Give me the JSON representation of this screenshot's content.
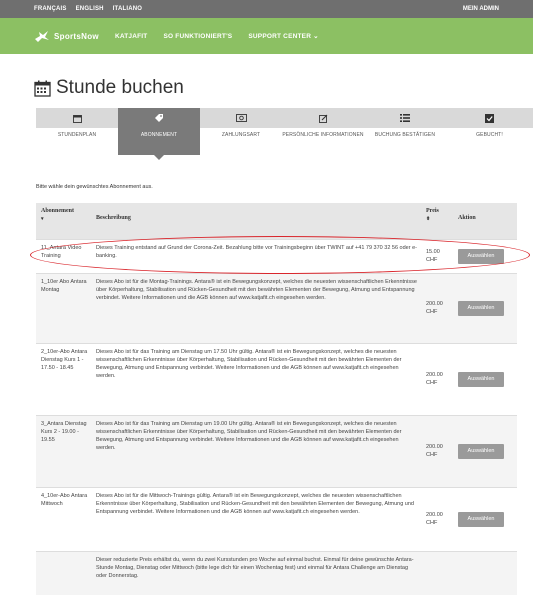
{
  "topbar": {
    "languages": [
      "FRANÇAIS",
      "ENGLISH",
      "ITALIANO"
    ],
    "right_label": "MEIN ADMIN"
  },
  "navbar": {
    "brand": "SportsNow",
    "items": [
      "KATJAFIT",
      "SO FUNKTIONIERT'S",
      "SUPPORT CENTER ⌄"
    ]
  },
  "page": {
    "title": "Stunde buchen"
  },
  "steps": [
    {
      "label": "STUNDENPLAN",
      "icon": "calendar-icon"
    },
    {
      "label": "ABONNEMENT",
      "icon": "tag-icon"
    },
    {
      "label": "ZAHLUNGSART",
      "icon": "money-icon"
    },
    {
      "label": "PERSÖNLICHE INFORMATIONEN",
      "icon": "edit-icon"
    },
    {
      "label": "BUCHUNG BESTÄTIGEN",
      "icon": "list-icon"
    },
    {
      "label": "GEBUCHT!",
      "icon": "check-icon"
    }
  ],
  "hint": "Bitte wähle dein gewünschtes Abonnement aus.",
  "table": {
    "headers": {
      "abo": "Abonnement",
      "desc": "Beschreibung",
      "price": "Preis",
      "action": "Aktion"
    },
    "sort_glyph_abo": "▾",
    "sort_glyph_price": "⬍",
    "button_label": "Auswählen",
    "rows": [
      {
        "name": "11_Antara Video Training",
        "desc": "Dieses Training entstand auf Grund der Corona-Zeit. Bezahlung bitte vor Trainingsbeginn über TWINT auf +41 79 370 32 56 oder e-banking.",
        "price": "15.00 CHF"
      },
      {
        "name": "1_10er Abo Antara Montag",
        "desc": "Dieses Abo ist für die Montag-Trainings. Antara® ist ein Bewegungskonzept, welches die neuesten wissenschaftlichen Erkenntnisse über Körperhaltung, Stabilisation und Rücken-Gesundheit mit den bewährten Elementen der Bewegung, Atmung und Entspannung verbindet. Weitere Informationen und die AGB können auf www.katjafit.ch eingesehen werden.",
        "price": "200.00 CHF"
      },
      {
        "name": "2_10er-Abo Antara Dienstag Kurs 1 - 17.50 - 18.45",
        "desc": "Dieses Abo ist für das Training am Dienstag um 17.50 Uhr gültig. Antara® ist ein Bewegungskonzept, welches die neuesten wissenschaftlichen Erkenntnisse über Körperhaltung, Stabilisation und Rücken-Gesundheit mit den bewährten Elementen der Bewegung, Atmung und Entspannung verbindet. Weitere Informationen und die AGB können auf www.katjafit.ch eingesehen werden.",
        "price": "200.00 CHF"
      },
      {
        "name": "3_Antara Dienstag Kurs 2 - 19.00 - 19.55",
        "desc": "Dieses Abo ist für das Training am Dienstag um 19.00 Uhr gültig. Antara® ist ein Bewegungskonzept, welches die neuesten wissenschaftlichen Erkenntnisse über Körperhaltung, Stabilisation und Rücken-Gesundheit mit den bewährten Elementen der Bewegung, Atmung und Entspannung verbindet. Weitere Informationen und die AGB können auf www.katjafit.ch eingesehen werden.",
        "price": "200.00 CHF"
      },
      {
        "name": "4_10er-Abo Antara Mittwoch",
        "desc": "Dieses Abo ist für die Mittwoch-Trainings gültig. Antara® ist ein Bewegungskonzept, welches die neuesten wissenschaftlichen Erkenntnisse über Körperhaltung, Stabilisation und Rücken-Gesundheit mit den bewährten Elementen der Bewegung, Atmung und Entspannung verbindet. Weitere Informationen und die AGB können auf www.katjafit.ch eingesehen werden.",
        "price": "200.00 CHF"
      },
      {
        "name": "",
        "desc": "Dieser reduzierte Preis erhältst du, wenn du zwei Kursstunden pro Woche auf einmal buchst. Einmal für deine gewünschte Antara-Stunde Montag, Dienstag oder Mittwoch (bitte lege dich für einen Wochentag fest) und einmal für Antara Challenge am Dienstag oder Donnerstag.",
        "price": ""
      }
    ]
  },
  "colors": {
    "navbar": "#8cc063",
    "topbar": "#6f6f6f",
    "button": "#9a9a9a",
    "annotation": "#d9262c"
  }
}
